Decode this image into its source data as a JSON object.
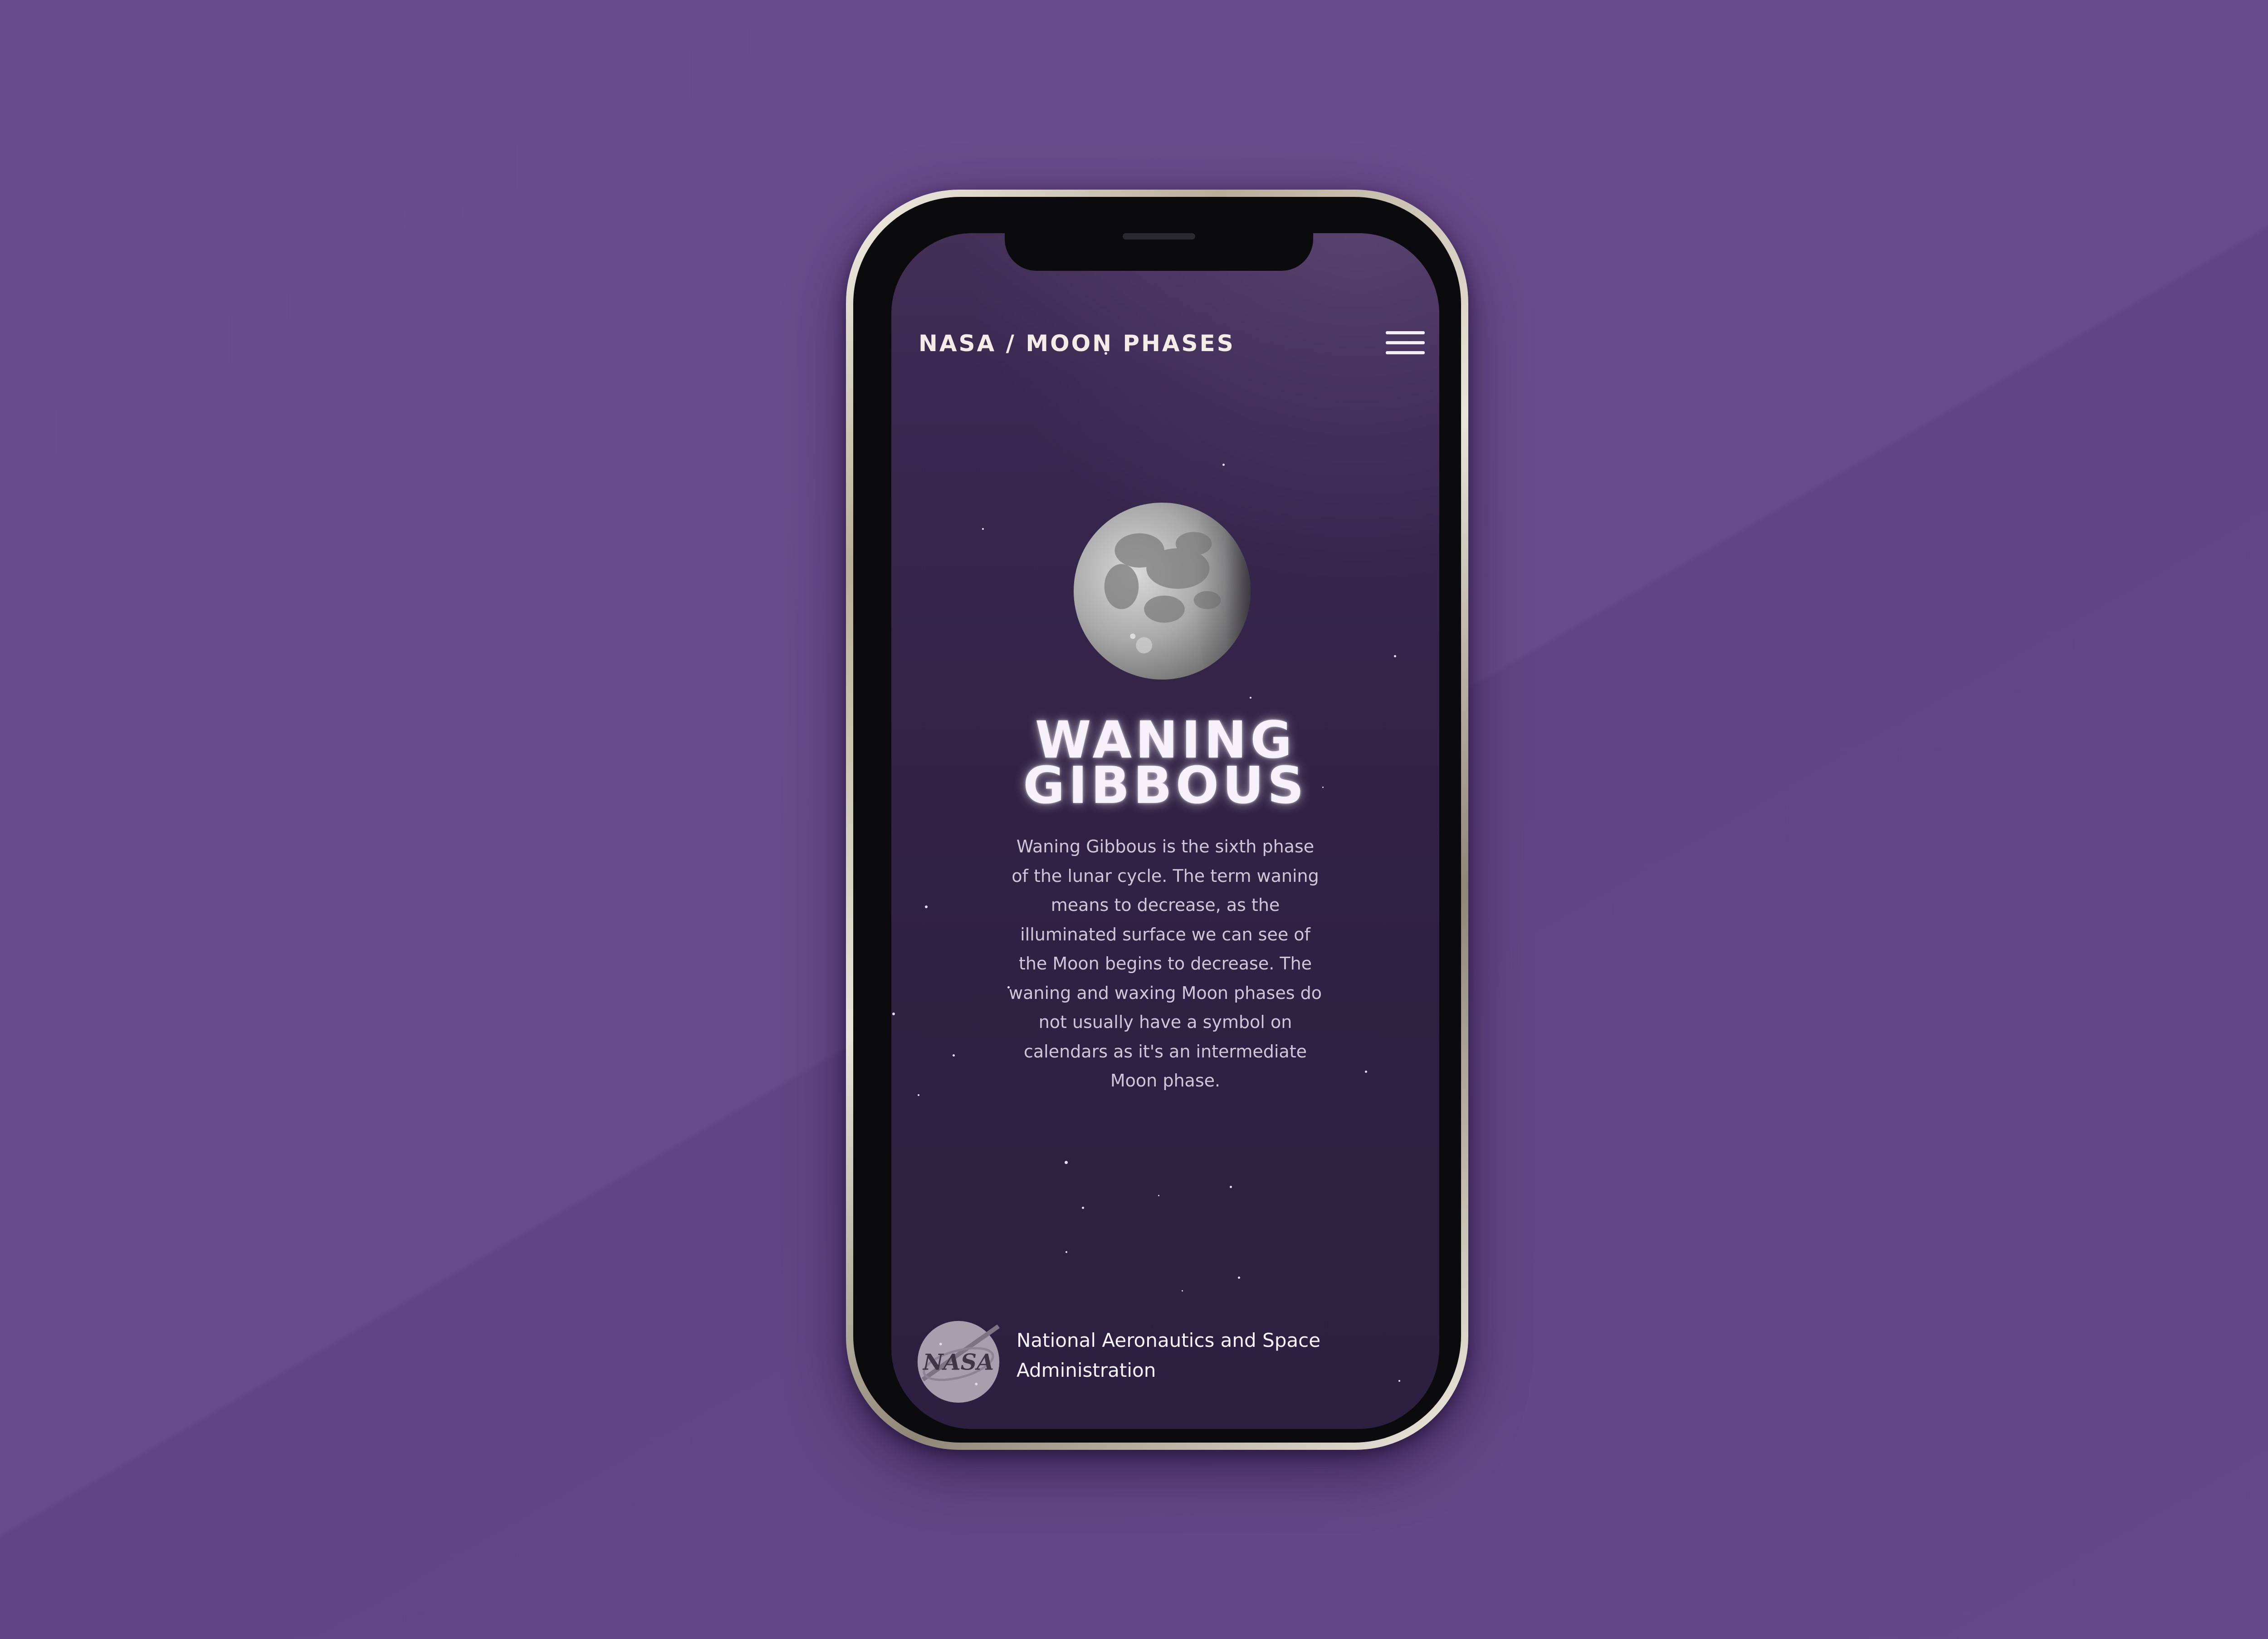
{
  "header": {
    "title": "NASA / MOON PHASES",
    "menu_icon": "hamburger-menu-icon"
  },
  "phase": {
    "title_line1": "WANING",
    "title_line2": "GIBBOUS",
    "description": "Waning Gibbous is the sixth phase of the lunar cycle. The term waning means to decrease, as the illuminated surface we can see of the Moon begins to decrease. The waning and waxing Moon phases do not usually have a symbol on calendars as it's an intermediate Moon phase."
  },
  "footer": {
    "logo_text": "NASA",
    "agency_name": "National Aeronautics and Space Administration"
  },
  "colors": {
    "background": "#684a8a",
    "screen_top": "#433057",
    "screen_bottom": "#2c1f3f",
    "text_light": "#f6f1fa",
    "text_muted": "#cfc6da"
  }
}
